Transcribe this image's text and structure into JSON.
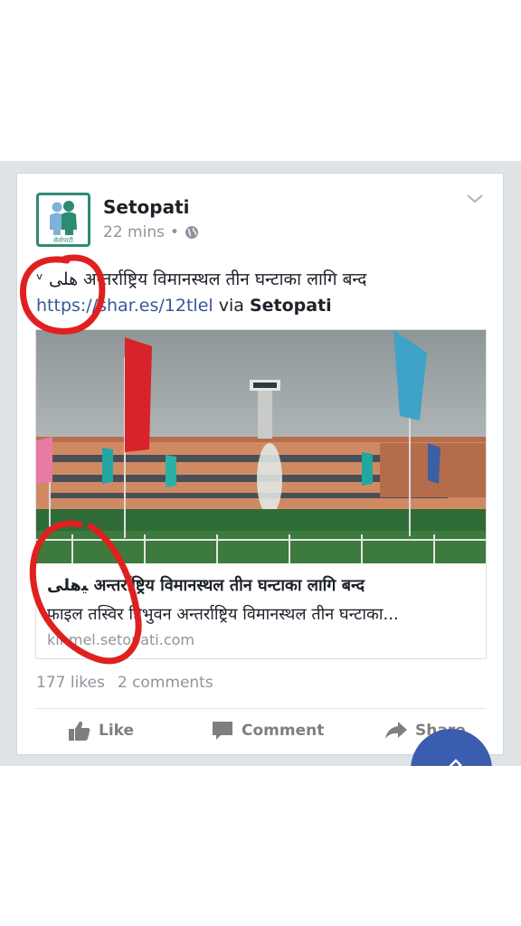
{
  "post": {
    "page_name": "Setopati",
    "time": "22 mins",
    "separator": "•",
    "text_prefix": "ᵛ ﻫﻠﯽ",
    "text_headline": "अन्तर्राष्ट्रिय विमानस्थल तीन घन्टाका लागि बन्द",
    "link": "https://shar.es/12tlel",
    "via_label": "via",
    "via_name": "Setopati"
  },
  "avatar": {
    "caption": "सेतोपाटी"
  },
  "link_preview": {
    "title": "ﯿﻫﻠﯽ अन्तर्राष्ट्रिय विमानस्थल तीन घन्टाका लागि बन्द",
    "description": "फाइल तस्विर त्रिभुवन अन्तर्राष्ट्रिय विमानस्थल तीन घन्टाका...",
    "domain": "kinmel.setopati.com"
  },
  "stats": {
    "likes": "177 likes",
    "comments": "2 comments"
  },
  "actions": {
    "like": "Like",
    "comment": "Comment",
    "share": "Share"
  },
  "icons": {
    "globe": "globe-icon",
    "chevron": "chevron-down-icon",
    "like": "thumbs-up-icon",
    "comment": "comment-bubble-icon",
    "share": "share-arrow-icon",
    "compose": "pencil-icon"
  },
  "colors": {
    "link": "#365899",
    "brand_green": "#2d8a73",
    "action_gray": "#7f7f7f",
    "annotation_red": "#e02020",
    "fab_blue": "#3b5db0"
  }
}
